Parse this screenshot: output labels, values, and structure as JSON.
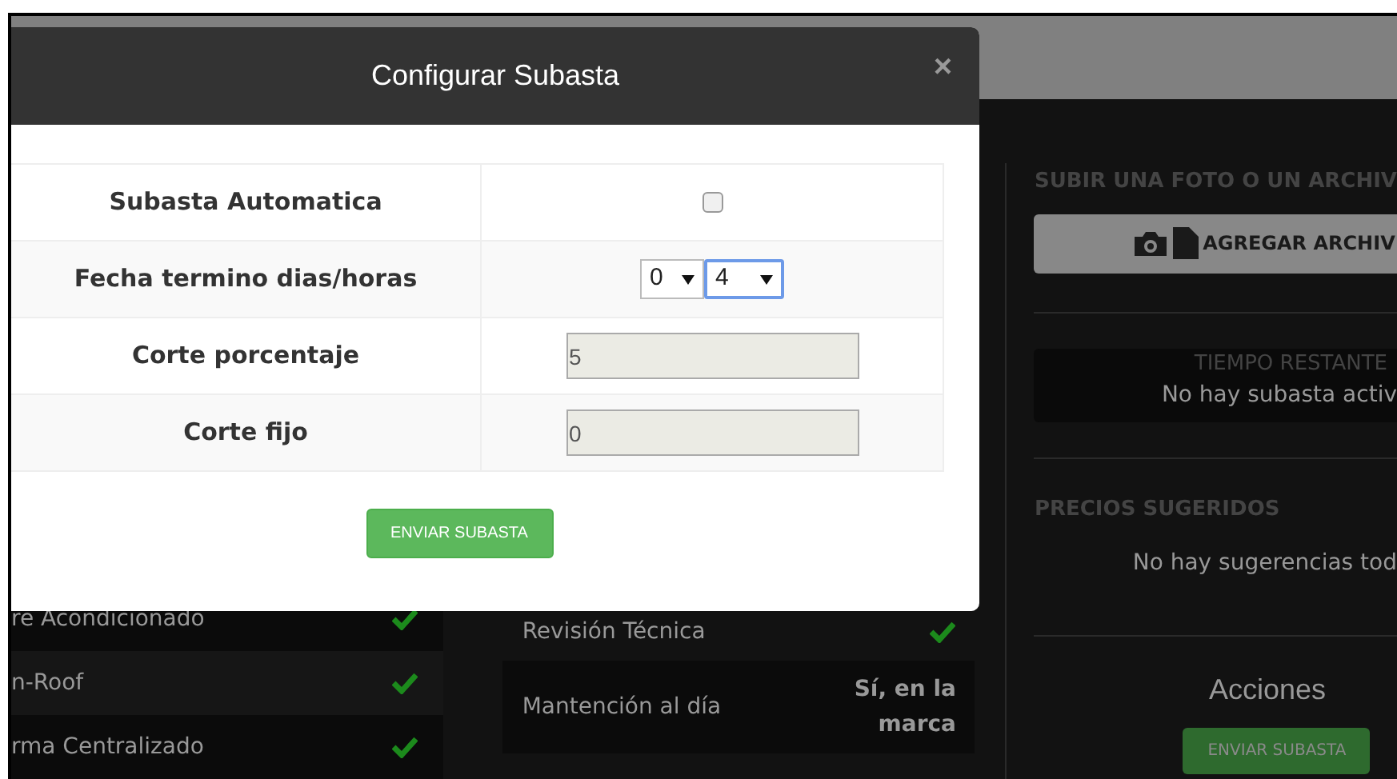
{
  "modal": {
    "title": "Configurar Subasta",
    "close": "×",
    "submit": "ENVIAR SUBASTA",
    "fields": [
      {
        "kind": "checkbox",
        "label": "Subasta Automatica",
        "checked": false
      },
      {
        "kind": "selects",
        "label": "Fecha termino dias/horas",
        "selects": [
          {
            "value": "0",
            "focused": false
          },
          {
            "value": "4",
            "focused": true
          }
        ]
      },
      {
        "kind": "input",
        "label": "Corte porcentaje",
        "value": "5"
      },
      {
        "kind": "input",
        "label": "Corte fijo",
        "value": "0"
      }
    ]
  },
  "features": [
    {
      "label": "re Acondicionado",
      "checked": true
    },
    {
      "label": "n-Roof",
      "checked": true
    },
    {
      "label": "rma Centralizado",
      "checked": true
    }
  ],
  "details": [
    {
      "kind": "check",
      "label": "Revisión Técnica",
      "checked": true
    },
    {
      "kind": "value",
      "label": "Mantención al día",
      "value": "Sí, en la marca"
    }
  ],
  "sidebar": {
    "upload_heading": "SUBIR UNA FOTO O UN ARCHIV",
    "upload_button": "AGREGAR ARCHIV",
    "timer": {
      "heading": "TIEMPO RESTANTE",
      "text": "No hay subasta activ"
    },
    "prices": {
      "heading": "PRECIOS SUGERIDOS",
      "text": "No hay sugerencias tod"
    },
    "actions": {
      "heading": "Acciones",
      "button": "ENVIAR SUBASTA"
    }
  }
}
